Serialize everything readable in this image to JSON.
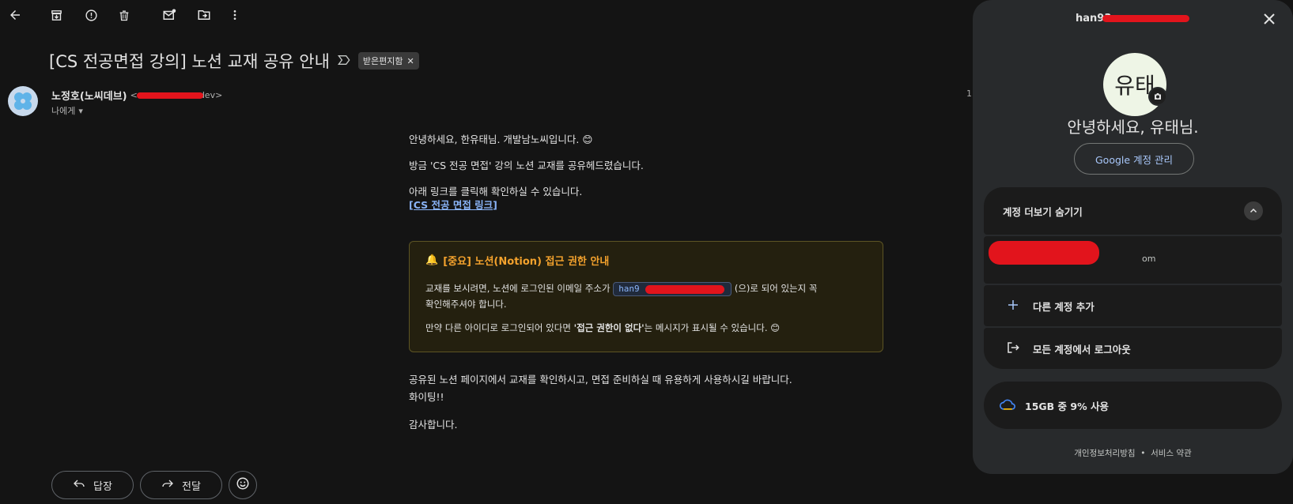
{
  "toolbar": {
    "icons": [
      "back-arrow-icon",
      "archive-icon",
      "report-spam-icon",
      "delete-icon",
      "mark-unread-icon",
      "move-to-icon",
      "more-vert-icon"
    ]
  },
  "email": {
    "subject": "[CS 전공면접 강의] 노션 교재 공유 안내",
    "label": "받은편지함",
    "sender_name": "노정호(노씨데브)",
    "sender_email_visible": "<",
    "sender_email_tail": "dev>",
    "to": "나에게",
    "time": "1",
    "greeting": "안녕하세요, 한유태님. 개발남노씨입니다. 😊",
    "line1": "방금 'CS 전공 면접' 강의 노션 교재를 공유헤드렸습니다.",
    "line2": "아래 링크를 클릭해 확인하실 수 있습니다.",
    "link": "[CS 전공 면접 링크]",
    "notice_title": "[중요] 노션(Notion) 접근 권한 안내",
    "notice_p1_a": "교재를 보시려면, 노션에 로그인된 이메일 주소가",
    "notice_email": "han9",
    "notice_p1_b": "(으)로 되어 있는지 꼭",
    "notice_p1_c": "확인해주셔야 합니다.",
    "notice_p2_a": "만약 다른 아이디로 로그인되어 있다면",
    "notice_p2_bold": "'접근 권한이 없다'",
    "notice_p2_b": "는 메시지가 표시될 수 있습니다. 😊",
    "after1": "공유된 노션 페이지에서 교재를 확인하시고, 면접 준비하실 때 유용하게 사용하시길 바랍니다.",
    "after2": "화이팅!!",
    "thanks": "감사합니다.",
    "reply": "답장",
    "forward": "전달"
  },
  "account_panel": {
    "email": "han93",
    "avatar_text": "유태",
    "greeting": "안녕하세요, 유태님.",
    "manage": "Google 계정 관리",
    "more_accounts": "계정 더보기 숨기기",
    "account_tail": "om",
    "add_account": "다른 계정 추가",
    "logout": "모든 계정에서 로그아웃",
    "storage": "15GB 중 9% 사용",
    "privacy": "개인정보처리방침",
    "terms": "서비스 약관",
    "separator": "•"
  }
}
